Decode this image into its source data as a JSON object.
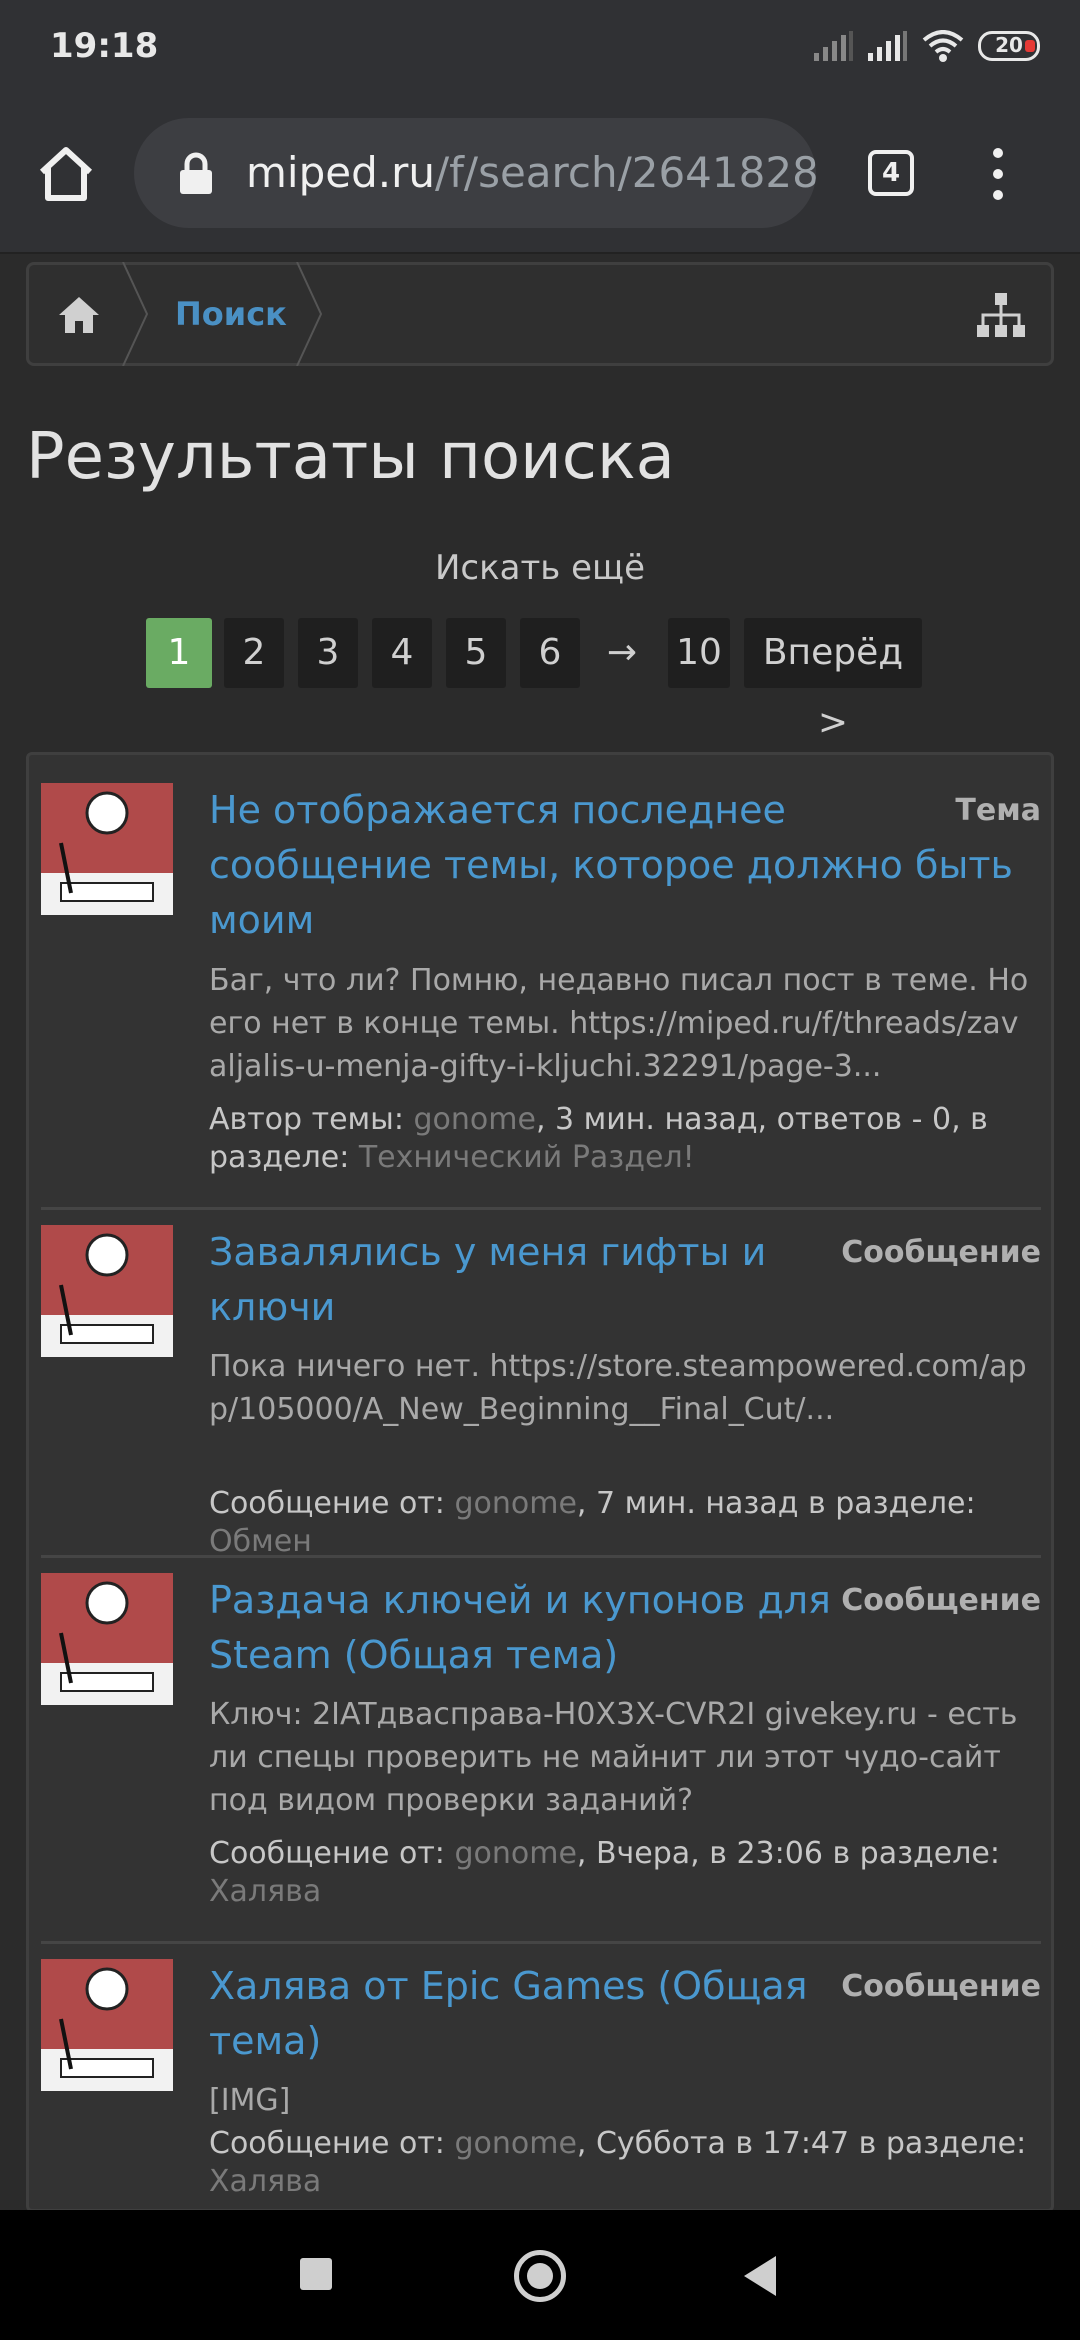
{
  "status_bar": {
    "time": "19:18",
    "battery": "20"
  },
  "browser": {
    "url_host": "miped.ru",
    "url_path": "/f/search/2641828",
    "tab_count": "4"
  },
  "breadcrumb": {
    "items": [
      "Поиск"
    ]
  },
  "page": {
    "title": "Результаты поиска",
    "search_more": "Искать ещё"
  },
  "pagination": {
    "pages": [
      "1",
      "2",
      "3",
      "4",
      "5",
      "6"
    ],
    "current": "1",
    "ellipsis": "→",
    "last": "10",
    "next": "Вперёд >"
  },
  "results": [
    {
      "title_lines": [
        "Не отображается последнее",
        "сообщение темы, которое должно быть",
        "моим"
      ],
      "type": "Тема",
      "snippet": "Баг, что ли? Помню, недавно писал пост в теме. Но его нет в конце темы. https://miped.ru/f/threads/zavaljalis-u-menja-gifty-i-kljuchi.32291/page-3...",
      "meta_prefix": "Автор темы: ",
      "author": "gonome",
      "meta_mid": ", 3 мин. назад, ответов - 0, в разделе: ",
      "section": "Технический Раздел!"
    },
    {
      "title_lines": [
        "Завалялись у меня гифты и",
        "ключи"
      ],
      "type": "Сообщение",
      "snippet": "Пока ничего нет. https://store.steampowered.com/app/105000/A_New_Beginning__Final_Cut/...",
      "meta_prefix": "Сообщение от: ",
      "author": "gonome",
      "meta_mid": ", 7 мин. назад в разделе: ",
      "section": "Обмен"
    },
    {
      "title_lines": [
        "Раздача ключей и купонов для",
        "Steam (Общая тема)"
      ],
      "type": "Сообщение",
      "snippet": "Ключ: 2IATдваcправа-H0X3X-CVR2I givekey.ru - есть ли спецы проверить не майнит ли этот чудо-сайт под видом проверки заданий?",
      "meta_prefix": "Сообщение от: ",
      "author": "gonome",
      "meta_mid": ", Вчера, в 23:06 в разделе: ",
      "section": "Халява"
    },
    {
      "title_lines": [
        "Халява от Epic Games (Общая",
        "тема)"
      ],
      "type": "Сообщение",
      "snippet": "[IMG]",
      "meta_prefix": "Сообщение от: ",
      "author": "gonome",
      "meta_mid": ", Суббота в 17:47 в разделе: ",
      "section": "Халява"
    }
  ]
}
